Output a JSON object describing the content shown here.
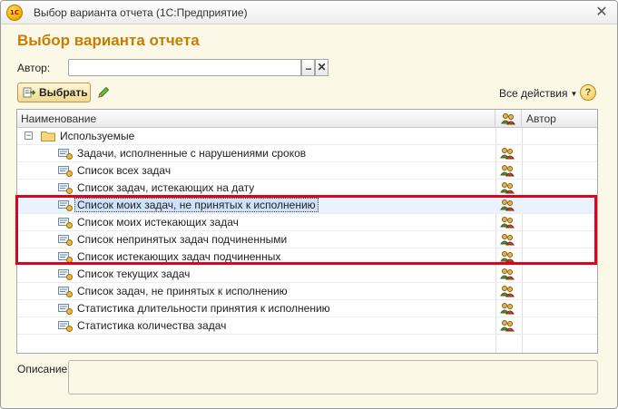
{
  "window": {
    "app_icon_text": "1С",
    "title": "Выбор варианта отчета  (1С:Предприятие)"
  },
  "form": {
    "title": "Выбор варианта отчета",
    "author_label": "Автор:",
    "author_value": "",
    "select_button_label": "...",
    "clear_button_label": "✕"
  },
  "toolbar": {
    "choose_label": "Выбрать",
    "all_actions_label": "Все действия",
    "help_label": "?"
  },
  "table": {
    "columns": {
      "name": "Наименование",
      "author": "Автор"
    },
    "group": {
      "label": "Используемые",
      "expander": "−"
    },
    "rows": [
      {
        "label": "Задачи, исполненные с нарушениями сроков",
        "author": ""
      },
      {
        "label": "Список всех задач",
        "author": ""
      },
      {
        "label": "Список задач, истекающих на дату",
        "author": ""
      },
      {
        "label": "Список моих задач, не принятых к исполнению",
        "author": ""
      },
      {
        "label": "Список моих истекающих задач",
        "author": ""
      },
      {
        "label": "Список непринятых задач подчиненными",
        "author": ""
      },
      {
        "label": "Список истекающих задач подчиненных",
        "author": ""
      },
      {
        "label": "Список текущих задач",
        "author": ""
      },
      {
        "label": "Список задач, не принятых к исполнению",
        "author": ""
      },
      {
        "label": "Статистика длительности принятия к исполнению",
        "author": ""
      },
      {
        "label": "Статистика количества задач",
        "author": ""
      }
    ],
    "selected_row": 3,
    "highlighted_rows": [
      3,
      4,
      5,
      6
    ],
    "highlight_color": "#e2001a"
  },
  "description": {
    "label": "Описание:",
    "value": ""
  },
  "colors": {
    "accent_title": "#c77e00",
    "window_bg": "#fbf8e8",
    "selection": "#cfe1fb"
  }
}
